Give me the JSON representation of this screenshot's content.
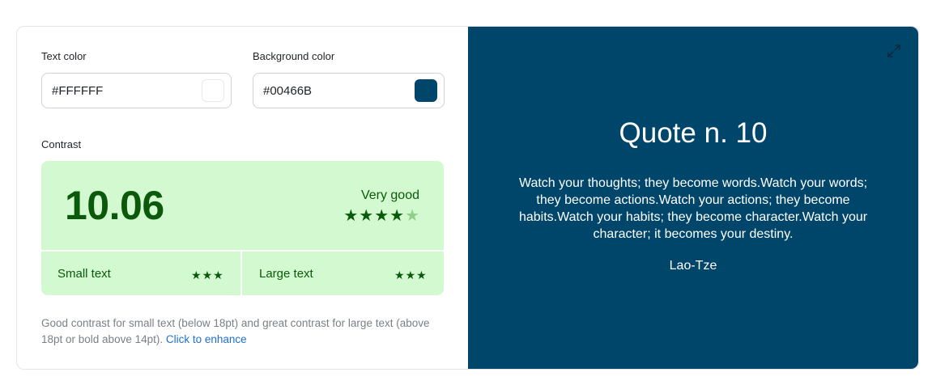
{
  "settings": {
    "text_color_label": "Text color",
    "text_color_value": "#FFFFFF",
    "background_color_label": "Background color",
    "background_color_value": "#00466B"
  },
  "contrast": {
    "label": "Contrast",
    "ratio": "10.06",
    "rating_text": "Very good",
    "rating_stars": 4,
    "rating_max": 5,
    "small_text_label": "Small text",
    "small_text_stars": 3,
    "large_text_label": "Large text",
    "large_text_stars": 3,
    "helper_text": "Good contrast for small text (below 18pt) and great contrast for large text (above 18pt or bold above 14pt).",
    "enhance_link": "Click to enhance"
  },
  "preview": {
    "title": "Quote n. 10",
    "quote": "Watch your thoughts; they become words.Watch your words; they become actions.Watch your actions; they become habits.Watch your habits; they become character.Watch your character; it becomes your destiny.",
    "author": "Lao-Tze",
    "expand_icon": "expand-icon"
  },
  "colors": {
    "text": "#FFFFFF",
    "background": "#00466B",
    "good_bg": "#d3f9d0",
    "good_fg": "#0b5a0b"
  }
}
